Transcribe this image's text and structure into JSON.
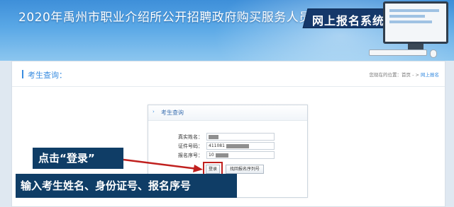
{
  "header": {
    "title": "2020年禹州市职业介绍所公开招聘政府购买服务人员",
    "system_badge": "网上报名系统"
  },
  "section": {
    "title": "考生查询："
  },
  "breadcrumb": {
    "prefix": "您现在的位置：首页 - > ",
    "current": "网上报名"
  },
  "query_box": {
    "title": "考生查询",
    "fields": [
      {
        "label": "真实姓名：",
        "value": ""
      },
      {
        "label": "证件号码：",
        "value": "411081"
      },
      {
        "label": "报名序号：",
        "value": "10"
      }
    ],
    "login_button": "登录",
    "recover_button": "找回报名序列号"
  },
  "annotations": {
    "click_login": "点击“登录”",
    "instruction": "输入考生姓名、身份证号、报名序号"
  },
  "colors": {
    "accent": "#3a8de0",
    "annotation_bg": "#0f3d66",
    "highlight": "#c0201e"
  }
}
